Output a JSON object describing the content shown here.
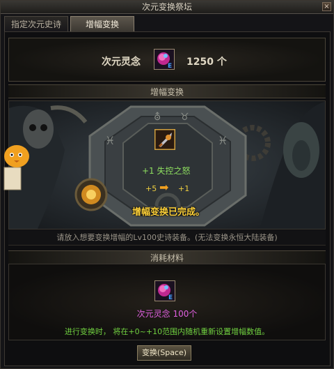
{
  "window": {
    "title": "次元变换祭坛",
    "close_label": "×"
  },
  "tabs": [
    {
      "label": "指定次元史诗",
      "active": false
    },
    {
      "label": "增幅变换",
      "active": true
    }
  ],
  "header": {
    "label": "次元灵念",
    "icon": "dimension-soul-icon",
    "count": "1250 个"
  },
  "amplify_section": {
    "title": "增幅变换",
    "item_icon": "weapon-icon",
    "item_name": "+1 失控之怒",
    "from_level": "+5",
    "to_level": "+1",
    "status": "增幅变换已完成。",
    "hint": "请放入想要变换增幅的Lv100史诗装备。(无法变换永恒大陆装备)"
  },
  "materials": {
    "title": "消耗材料",
    "icon": "dimension-soul-icon",
    "label": "次元灵念 100个",
    "hint": "进行变换时， 将在+0~+10范围内随机重新设置增幅数值。"
  },
  "convert_button": {
    "label": "变换(Space)"
  },
  "colors": {
    "accent_yellow": "#ffd23a",
    "green": "#8fe060",
    "magenta": "#e060e0"
  }
}
